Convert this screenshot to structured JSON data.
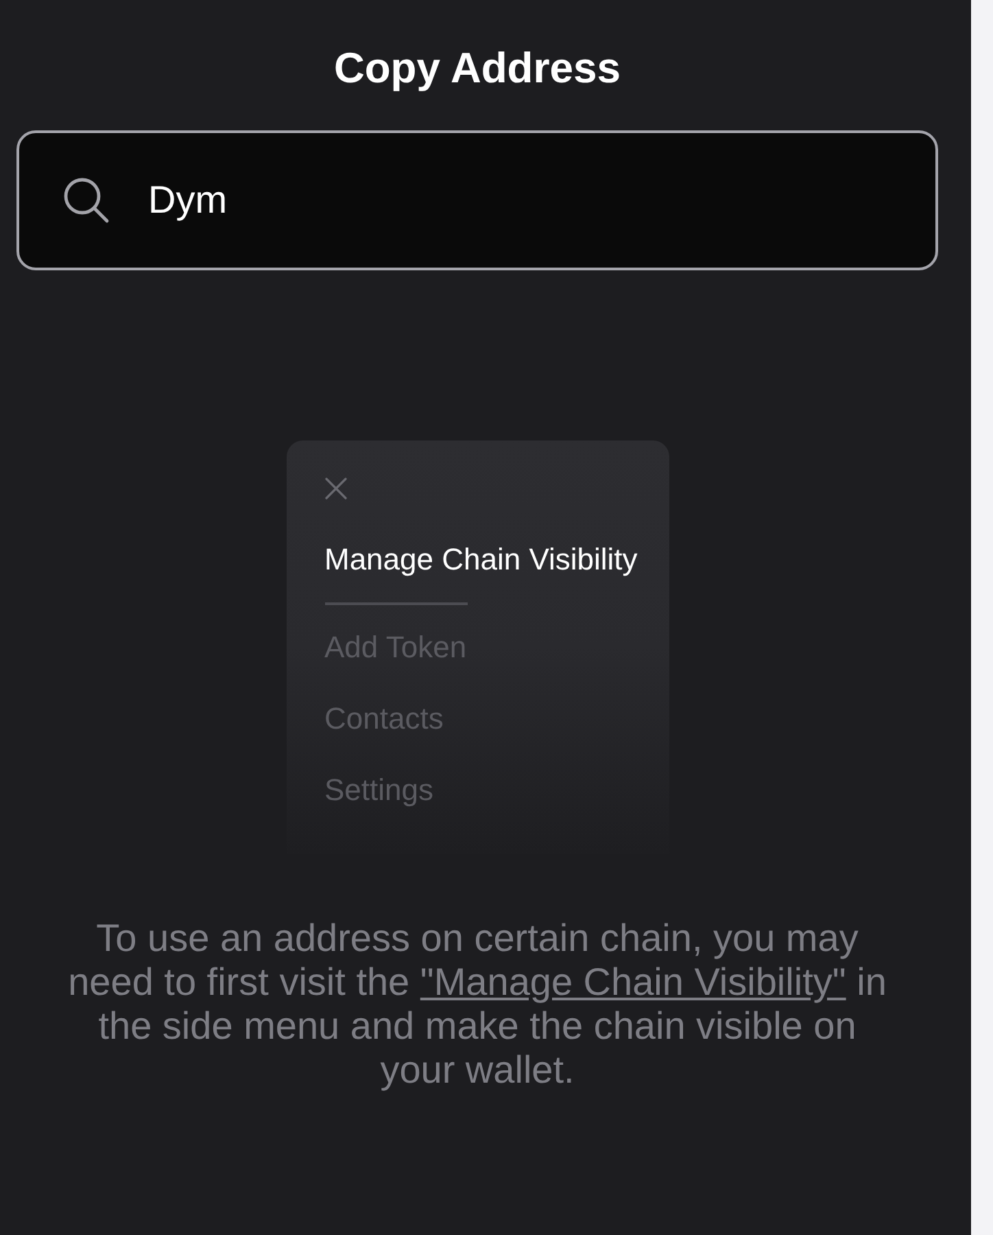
{
  "header": {
    "title": "Copy Address"
  },
  "search": {
    "value": "Dym"
  },
  "illustration": {
    "menu_items": [
      {
        "label": "Manage Chain Visibility",
        "selected": true
      },
      {
        "label": "Add Token",
        "selected": false
      },
      {
        "label": "Contacts",
        "selected": false
      },
      {
        "label": "Settings",
        "selected": false
      }
    ]
  },
  "hint": {
    "text_before": "To use an address on certain chain, you may need to first visit the ",
    "link": "\"Manage Chain Visibility\"",
    "text_after": " in the side menu and make the chain visible on your wallet."
  }
}
